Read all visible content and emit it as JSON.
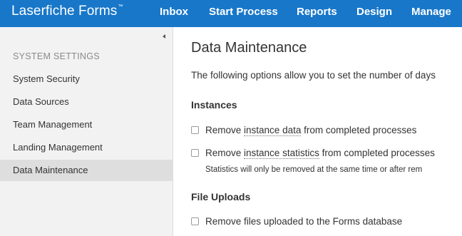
{
  "topbar": {
    "brand": "Laserfiche Forms",
    "brand_tm": "™",
    "nav": [
      "Inbox",
      "Start Process",
      "Reports",
      "Design",
      "Manage"
    ]
  },
  "sidebar": {
    "heading": "SYSTEM SETTINGS",
    "items": [
      {
        "label": "System Security"
      },
      {
        "label": "Data Sources"
      },
      {
        "label": "Team Management"
      },
      {
        "label": "Landing Management"
      },
      {
        "label": "Data Maintenance",
        "active": true
      }
    ]
  },
  "main": {
    "title": "Data Maintenance",
    "intro": "The following options allow you to set the number of days",
    "instances": {
      "title": "Instances",
      "opt1": {
        "pre": "Remove ",
        "highlight": "instance data",
        "post": " from completed processes"
      },
      "opt2": {
        "pre": "Remove ",
        "highlight": "instance statistics",
        "post": " from completed processes"
      },
      "note": "Statistics will only be removed at the same time or after rem"
    },
    "uploads": {
      "title": "File Uploads",
      "opt1": {
        "label": "Remove files uploaded to the Forms database"
      }
    }
  },
  "colors": {
    "topbar": "#1877c9",
    "sidebar_bg": "#f2f2f2",
    "sidebar_active": "#dedede"
  }
}
